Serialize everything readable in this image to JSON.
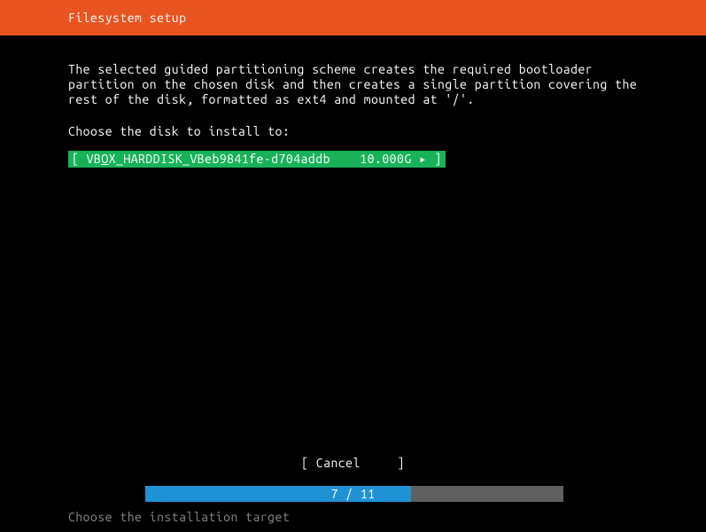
{
  "header": {
    "title": "Filesystem setup"
  },
  "description": {
    "line1": "The selected guided partitioning scheme creates the required bootloader",
    "line2": "partition on the chosen disk and then creates a single partition covering the",
    "line3": "rest of the disk, formatted as ext4 and mounted at '/'."
  },
  "prompt": "Choose the disk to install to:",
  "disk": {
    "prefix": "[ VB",
    "underline": "O",
    "name": "X_HARDDISK_VBeb9841fe-d704addb",
    "size": "10.000G",
    "arrow": "▸",
    "suffix": " ]"
  },
  "buttons": {
    "cancel": "[ Cancel     ]"
  },
  "progress": {
    "text": "7 / 11"
  },
  "help": "Choose the installation target"
}
